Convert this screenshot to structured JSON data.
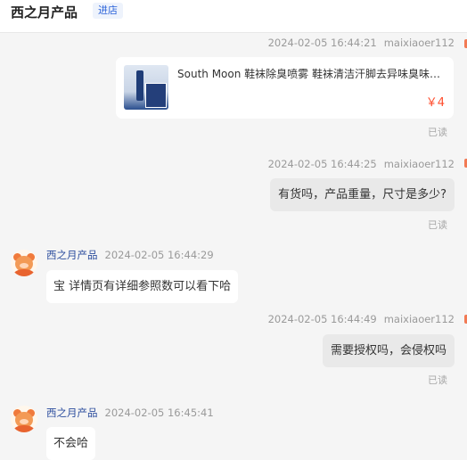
{
  "header": {
    "shop_name": "西之月产品",
    "enter_shop": "进店"
  },
  "messages": [
    {
      "type": "product",
      "time": "2024-02-05 16:44:21",
      "sender": "maixiaoer112",
      "product_title": "South Moon 鞋袜除臭喷雾 鞋袜清洁汗脚去异味臭味干...",
      "price": "￥4",
      "status": "已读"
    },
    {
      "type": "text",
      "time": "2024-02-05 16:44:25",
      "sender": "maixiaoer112",
      "text": "有货吗，产品重量，尺寸是多少?",
      "status": "已读"
    },
    {
      "type": "text",
      "time": "2024-02-05 16:44:29",
      "sender": "西之月产品",
      "text": "宝 详情页有详细参照数可以看下哈"
    },
    {
      "type": "text",
      "time": "2024-02-05 16:44:49",
      "sender": "maixiaoer112",
      "text": "需要授权吗，会侵权吗",
      "status": "已读"
    },
    {
      "type": "text",
      "time": "2024-02-05 16:45:41",
      "sender": "西之月产品",
      "text": "不会哈"
    }
  ]
}
